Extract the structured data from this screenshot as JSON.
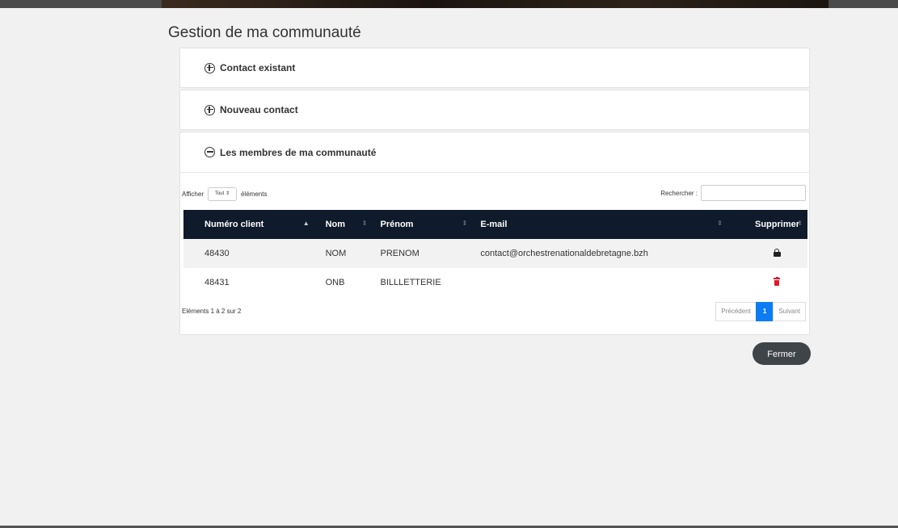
{
  "page": {
    "title": "Gestion de ma communauté"
  },
  "panels": [
    {
      "label": "Contact existant",
      "state": "collapsed",
      "icon": "plus-circle-icon"
    },
    {
      "label": "Nouveau contact",
      "state": "collapsed",
      "icon": "plus-circle-icon"
    },
    {
      "label": "Les membres de ma communauté",
      "state": "expanded",
      "icon": "minus-circle-icon"
    }
  ],
  "table_controls": {
    "show_prefix": "Afficher",
    "length_value": "Tout",
    "show_suffix": "éléments",
    "search_label": "Rechercher :",
    "search_value": ""
  },
  "table": {
    "columns": [
      "Numéro client",
      "Nom",
      "Prénom",
      "E-mail",
      "Supprimer"
    ],
    "rows": [
      {
        "client_id": "48430",
        "nom": "NOM",
        "prenom": "PRENOM",
        "email": "contact@orchestrenationaldebretagne.bzh",
        "action_icon": "lock-icon"
      },
      {
        "client_id": "48431",
        "nom": "ONB",
        "prenom": "BILLLETTERIE",
        "email": "",
        "action_icon": "trash-icon"
      }
    ]
  },
  "pagination": {
    "info": "Eléments 1 à 2 sur 2",
    "previous": "Précédent",
    "current": "1",
    "next": "Suivant"
  },
  "footer": {
    "close_label": "Fermer"
  },
  "colors": {
    "header_bg": "#0f1a2a",
    "pager_active": "#0d7cf2",
    "trash": "#e0192b",
    "close_bg": "#3f4448"
  }
}
